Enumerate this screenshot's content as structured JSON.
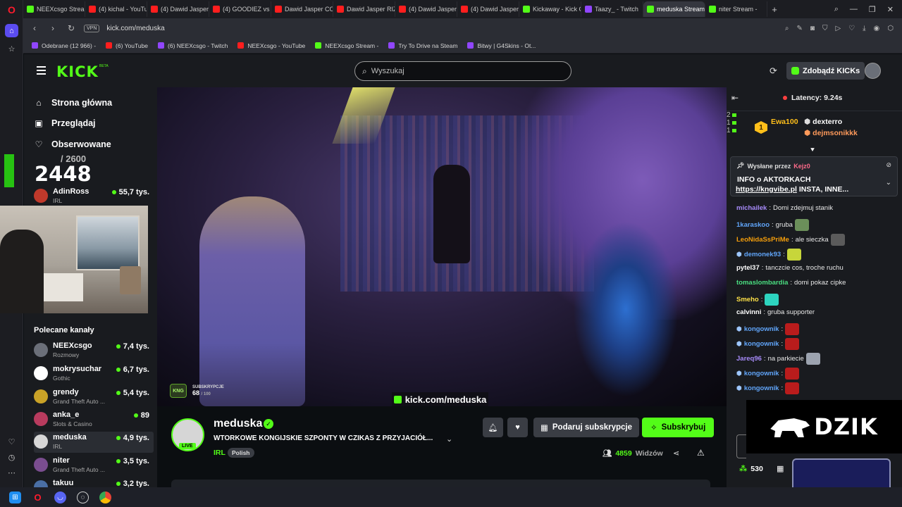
{
  "browser": {
    "tabs": [
      {
        "title": "NEEXcsgo Stream -",
        "type": "kick",
        "active": false
      },
      {
        "title": "(4) kichal - YouTube",
        "type": "yt",
        "active": false
      },
      {
        "title": "(4) Dawid Jasper SK",
        "type": "yt",
        "active": false
      },
      {
        "title": "(4) GOODIEZ vs TIK",
        "type": "yt",
        "active": false
      },
      {
        "title": "Dawid Jasper CO U",
        "type": "yt",
        "active": false
      },
      {
        "title": "Dawid Jasper RIZZL",
        "type": "yt",
        "active": false
      },
      {
        "title": "(4) Dawid Jasper PO",
        "type": "yt",
        "active": false
      },
      {
        "title": "(4) Dawid Jasper OI",
        "type": "yt",
        "active": false
      },
      {
        "title": "Kickaway - Kick Give",
        "type": "kick",
        "active": false
      },
      {
        "title": "Taazy_ - Twitch",
        "type": "tw",
        "active": false
      },
      {
        "title": "meduska Stream - Wa",
        "type": "kick",
        "active": true
      },
      {
        "title": "niter Stream -",
        "type": "kick",
        "active": false
      }
    ],
    "new_tab": "+",
    "url": "kick.com/meduska",
    "vpn": "VPN",
    "bookmarks": [
      {
        "label": "Odebrane (12 966) -",
        "type": "tw"
      },
      {
        "label": "(6) YouTube",
        "type": "yt"
      },
      {
        "label": "(6) NEEXcsgo - Twitch",
        "type": "tw"
      },
      {
        "label": "NEEXcsgo - YouTube",
        "type": "yt"
      },
      {
        "label": "NEEXcsgo Stream -",
        "type": "kick"
      },
      {
        "label": "Try To Drive na Steam",
        "type": "tw"
      },
      {
        "label": "Bitwy | G4Skins - Ot...",
        "type": "tw"
      }
    ]
  },
  "header": {
    "logo": "KICK",
    "beta": "BETA",
    "search_placeholder": "Wyszukaj",
    "kicks_button": "Zdobądź KICKs"
  },
  "sidebar": {
    "nav": [
      {
        "label": "Strona główna",
        "icon": "home-icon"
      },
      {
        "label": "Przeglądaj",
        "icon": "browse-icon"
      },
      {
        "label": "Obserwowane",
        "icon": "heart-icon"
      }
    ],
    "sub_goal_total": "/ 2600",
    "sub_goal_current": "2448",
    "followed": [
      {
        "name": "AdinRoss",
        "category": "IRL",
        "viewers": "55,7 tys.",
        "color": "#c0392b"
      }
    ],
    "recommended_title": "Polecane kanały",
    "recommended": [
      {
        "name": "NEEXcsgo",
        "category": "Rozmowy",
        "viewers": "7,4 tys.",
        "color": "#6b6f79"
      },
      {
        "name": "mokrysuchar",
        "category": "Gothic",
        "viewers": "6,7 tys.",
        "color": "#ffffff"
      },
      {
        "name": "grendy",
        "category": "Grand Theft Auto ...",
        "viewers": "5,4 tys.",
        "color": "#c9a227"
      },
      {
        "name": "anka_e",
        "category": "Slots & Casino",
        "viewers": "89",
        "color": "#b83b5e"
      },
      {
        "name": "meduska",
        "category": "IRL",
        "viewers": "4,9 tys.",
        "color": "#d7d7d7"
      },
      {
        "name": "niter",
        "category": "Grand Theft Auto ...",
        "viewers": "3,5 tys.",
        "color": "#7a4d8f"
      },
      {
        "name": "takuu",
        "category": "",
        "viewers": "3,2 tys.",
        "color": "#4a6fa5"
      }
    ]
  },
  "video": {
    "sub_label": "SUBSKRYPCJE",
    "sub_current": "68",
    "sub_target": "/ 100",
    "sub_logo": "KNG",
    "url_overlay": "kick.com/meduska"
  },
  "stream": {
    "streamer": "meduska",
    "live": "LIVE",
    "title": "WTORKOWE KONGIJSKIE SZPONTY W CZIKAS Z PRZYJACIÓŁ...",
    "category": "IRL",
    "language": "Polish",
    "gift_button": "Podaruj subskrypcje",
    "subscribe_button": "Subskrybuj",
    "viewers": "4859",
    "viewers_label": "Widzów"
  },
  "chat": {
    "latency": "Latency: 9.24s",
    "top_gifters": [
      {
        "name": "Ewa100",
        "count": "2",
        "color": "#ffbf1a",
        "rank": "1"
      },
      {
        "name": "dexterro",
        "count": "1",
        "color": "#ffffff"
      },
      {
        "name": "dejmsonikkk",
        "count": "1",
        "color": "#ff9a5a"
      }
    ],
    "pinned": {
      "by_label": "Wysłane przez",
      "by_user": "Kejz0",
      "title": "INFO o AKTORKACH",
      "link": "https://kngvibe.pl",
      "rest": " INSTA, INNE..."
    },
    "messages": [
      {
        "user": "michailek",
        "text": "Domi zdejmuj stanik",
        "color": "#a78bfa",
        "emote": ""
      },
      {
        "user": "1karaskoo",
        "text": "gruba",
        "color": "#60a5fa",
        "emote": "#6b8f5a"
      },
      {
        "user": "LeoNidaSsPriMe",
        "text": "ale sieczka",
        "color": "#f59e0b",
        "emote": "#5b5b5b"
      },
      {
        "user": "demonek93",
        "text": "",
        "color": "#60a5fa",
        "emote": "#c7d63a"
      },
      {
        "user": "pytel37",
        "text": "tanczcie cos, troche ruchu",
        "color": "#ffffff",
        "emote": ""
      },
      {
        "user": "tomaslombardia",
        "text": "domi pokaz cipke",
        "color": "#4ade80",
        "emote": ""
      },
      {
        "user": "Smeho",
        "text": "",
        "color": "#fde047",
        "emote": "#2dd4bf"
      },
      {
        "user": "calvinni",
        "text": "gruba supporter",
        "color": "#ffffff",
        "emote": ""
      },
      {
        "user": "kongownik",
        "text": "",
        "color": "#60a5fa",
        "emote": "#b91c1c"
      },
      {
        "user": "kongownik",
        "text": "",
        "color": "#60a5fa",
        "emote": "#b91c1c"
      },
      {
        "user": "Jareq96",
        "text": "na parkiecie",
        "color": "#a78bfa",
        "emote": "#9ca3af"
      },
      {
        "user": "kongownik",
        "text": "",
        "color": "#60a5fa",
        "emote": "#b91c1c"
      },
      {
        "user": "kongownik",
        "text": "",
        "color": "#60a5fa",
        "emote": "#b91c1c"
      }
    ],
    "ad_text": "DZIK",
    "points": "530"
  },
  "colors": {
    "kick_green": "#53fc18",
    "bg": "#0b0e11",
    "panel": "#191b1f"
  }
}
